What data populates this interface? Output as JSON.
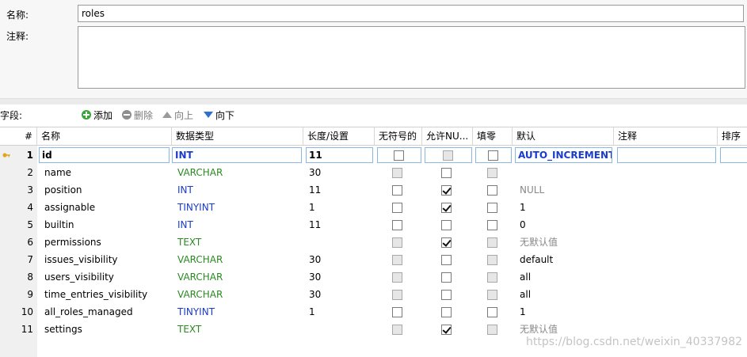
{
  "form": {
    "name_label": "名称:",
    "name_value": "roles",
    "comment_label": "注释:",
    "comment_value": ""
  },
  "toolbar": {
    "fields_label": "字段:",
    "add": "添加",
    "delete": "删除",
    "move_up": "向上",
    "move_down": "向下"
  },
  "columns": {
    "num": "#",
    "name": "名称",
    "type": "数据类型",
    "length": "长度/设置",
    "unsigned": "无符号的",
    "nullable": "允许NU...",
    "zerofill": "填零",
    "default": "默认",
    "comment": "注释",
    "sort": "排序"
  },
  "rows": [
    {
      "num": "1",
      "name": "id",
      "type": "INT",
      "length": "11",
      "default": "AUTO_INCREMENT"
    },
    {
      "num": "2",
      "name": "name",
      "type": "VARCHAR",
      "length": "30",
      "default": ""
    },
    {
      "num": "3",
      "name": "position",
      "type": "INT",
      "length": "11",
      "default": "NULL"
    },
    {
      "num": "4",
      "name": "assignable",
      "type": "TINYINT",
      "length": "1",
      "default": "1"
    },
    {
      "num": "5",
      "name": "builtin",
      "type": "INT",
      "length": "11",
      "default": "0"
    },
    {
      "num": "6",
      "name": "permissions",
      "type": "TEXT",
      "length": "",
      "default": "无默认值"
    },
    {
      "num": "7",
      "name": "issues_visibility",
      "type": "VARCHAR",
      "length": "30",
      "default": "default"
    },
    {
      "num": "8",
      "name": "users_visibility",
      "type": "VARCHAR",
      "length": "30",
      "default": "all"
    },
    {
      "num": "9",
      "name": "time_entries_visibility",
      "type": "VARCHAR",
      "length": "30",
      "default": "all"
    },
    {
      "num": "10",
      "name": "all_roles_managed",
      "type": "TINYINT",
      "length": "1",
      "default": "1"
    },
    {
      "num": "11",
      "name": "settings",
      "type": "TEXT",
      "length": "",
      "default": "无默认值"
    }
  ],
  "watermark": "https://blog.csdn.net/weixin_40337982",
  "colors": {
    "type_int": "#1a3ccd",
    "type_varchar": "#2a8a1f",
    "accent_blue": "#2f6fd0",
    "selection_border": "#8ab8e6",
    "key_icon": "#e0a820"
  }
}
